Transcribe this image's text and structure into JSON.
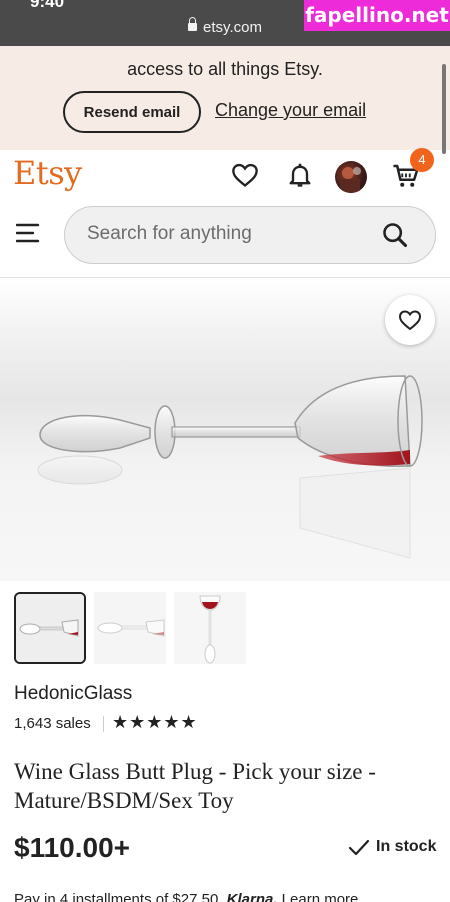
{
  "status_bar": {
    "time": "9:40"
  },
  "browser": {
    "url": "etsy.com"
  },
  "watermark": "fapellino.net",
  "banner": {
    "text": "access to all things Etsy.",
    "resend_label": "Resend email",
    "change_label": "Change your email"
  },
  "header": {
    "logo": "Etsy",
    "cart_count": "4",
    "search_placeholder": "Search for anything"
  },
  "listing": {
    "shop_name": "HedonicGlass",
    "sales": "1,643 sales",
    "rating_stars": "★★★★★",
    "rating": 5,
    "title": "Wine Glass Butt Plug - Pick your size - Mature/BSDM/Sex Toy",
    "price": "$110.00+",
    "stock": "In stock",
    "installments_text": "Pay in 4 installments of $27.50.",
    "installments_provider": "Klarna.",
    "installments_link": "Learn more"
  },
  "colors": {
    "brand": "#e36b21",
    "badge": "#f1641e",
    "banner_bg": "#f7ece5",
    "watermark_bg": "#ee2bd9"
  },
  "icons": [
    "lock-icon",
    "heart-icon",
    "bell-icon",
    "cart-icon",
    "menu-icon",
    "search-icon",
    "check-icon"
  ]
}
